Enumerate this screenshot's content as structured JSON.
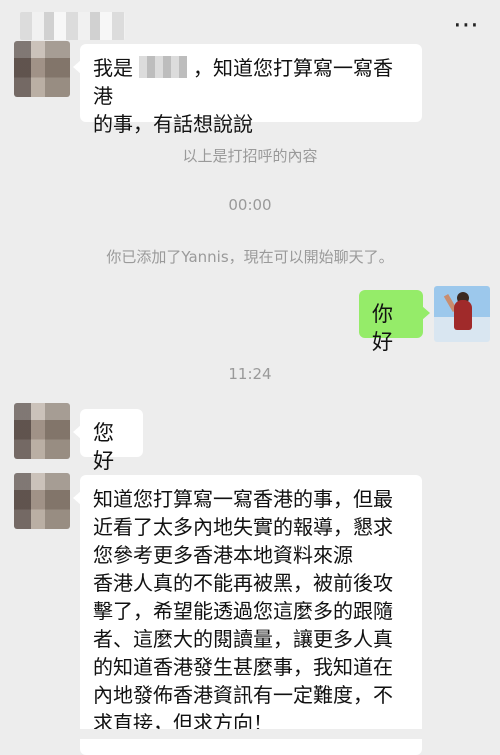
{
  "header": {
    "more_icon": "⋯"
  },
  "messages": [
    {
      "text_before": "我是",
      "text_after": "，知道您打算寫一寫香港\n的事，有話想說說"
    },
    {
      "text": "以上是打招呼的內容"
    },
    {
      "text": "00:00"
    },
    {
      "text": "你已添加了Yannis，現在可以開始聊天了。"
    },
    {
      "text": "你好"
    },
    {
      "text": "11:24"
    },
    {
      "text": "您好"
    },
    {
      "text": "知道您打算寫一寫香港的事，但最\n近看了太多內地失實的報導，懇求\n您參考更多香港本地資料來源\n香港人真的不能再被黑，被前後攻\n擊了，希望能透過您這麼多的跟隨\n者、這麼大的閱讀量，讓更多人真\n的知道香港發生甚麼事，我知道在\n內地發佈香港資訊有一定難度，不\n求直接，但求方向！"
    }
  ]
}
